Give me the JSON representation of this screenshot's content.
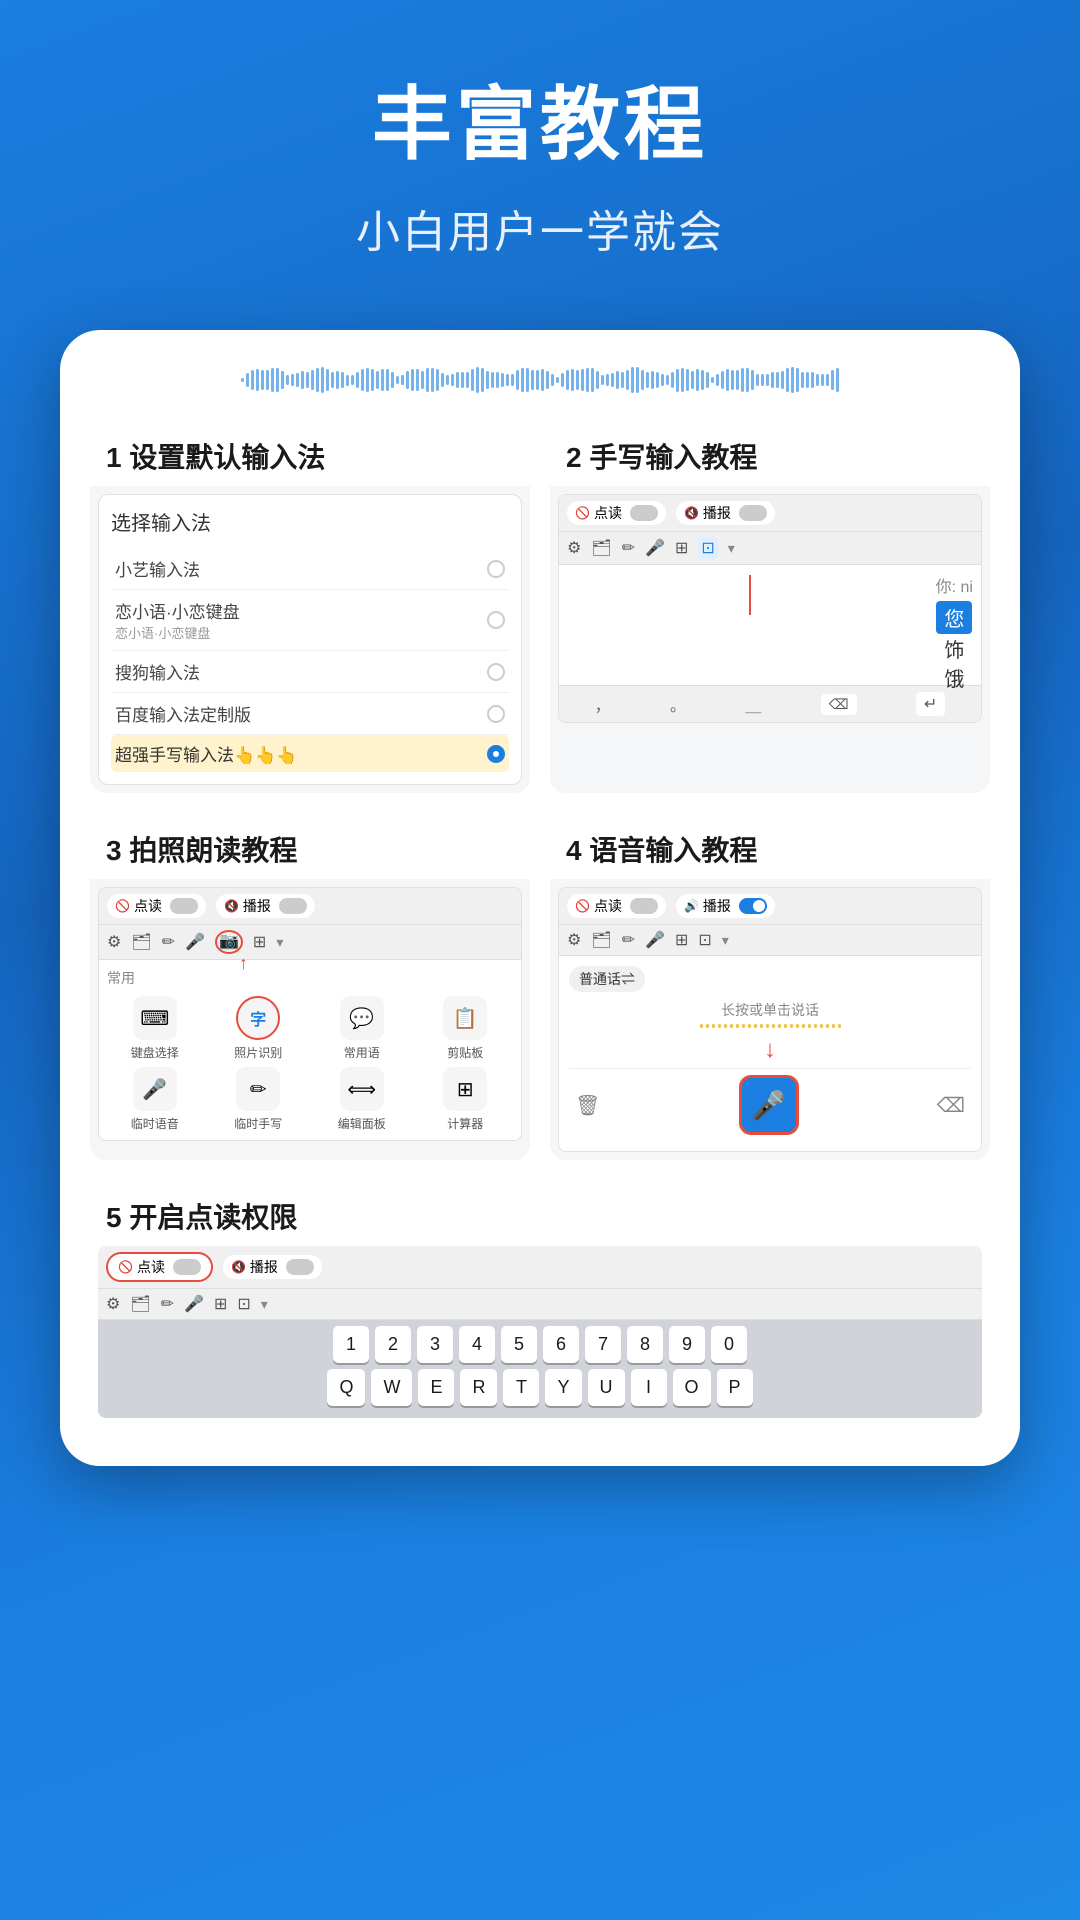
{
  "header": {
    "title": "丰富教程",
    "subtitle": "小白用户一学就会"
  },
  "tutorials": [
    {
      "id": 1,
      "label": "1 设置默认输入法",
      "content": {
        "title": "选择输入法",
        "items": [
          {
            "name": "小艺输入法",
            "selected": false
          },
          {
            "name": "恋小语·小恋键盘",
            "sub": "恋小语·小恋键盘",
            "selected": false
          },
          {
            "name": "搜狗输入法",
            "selected": false
          },
          {
            "name": "百度输入法定制版",
            "selected": false
          },
          {
            "name": "超强手写输入法👆👆👆",
            "selected": true,
            "highlight": true
          }
        ]
      }
    },
    {
      "id": 2,
      "label": "2 手写输入教程",
      "content": {
        "toggles": [
          "点读",
          "播报"
        ],
        "inputText": "你: ni",
        "suggestions": [
          "您",
          "饰",
          "饿"
        ],
        "highlight": "您"
      }
    },
    {
      "id": 3,
      "label": "3 拍照朗读教程",
      "content": {
        "toggles": [
          "点读",
          "播报"
        ],
        "sectionTitle": "常用",
        "functions": [
          {
            "icon": "⌨",
            "label": "键盘选择"
          },
          {
            "icon": "字",
            "label": "照片识别",
            "highlighted": true
          },
          {
            "icon": "💬",
            "label": "常用语"
          },
          {
            "icon": "📋",
            "label": "剪贴板"
          },
          {
            "icon": "🎤",
            "label": "临时语音"
          },
          {
            "icon": "✏",
            "label": "临时手写"
          },
          {
            "icon": "⟺",
            "label": "编辑面板"
          },
          {
            "icon": "⊞",
            "label": "计算器"
          }
        ]
      }
    },
    {
      "id": 4,
      "label": "4 语音输入教程",
      "content": {
        "toggles": [
          "点读",
          "播报"
        ],
        "language": "普通话⇌",
        "hint": "长按或单击说话",
        "hasBlueToggle": true
      }
    }
  ],
  "tutorial5": {
    "label": "5 开启点读权限",
    "toggleLabel": "点读",
    "toggleLabel2": "播报",
    "keyboardRows": [
      [
        "Q",
        "W",
        "E",
        "R",
        "T",
        "Y",
        "U",
        "I",
        "O",
        "P"
      ]
    ]
  },
  "colors": {
    "blue": "#1a7fe0",
    "red": "#e74c3c",
    "yellow": "#f0c040",
    "bg": "#1565c0"
  }
}
